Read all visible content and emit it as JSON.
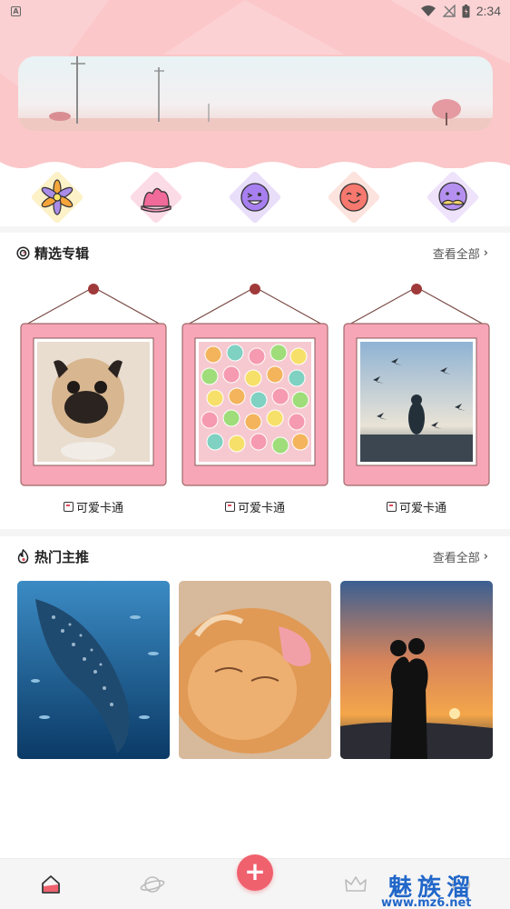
{
  "status_bar": {
    "time": "2:34"
  },
  "categories": [
    {
      "icon": "flower-icon",
      "color": "#fdf1c8"
    },
    {
      "icon": "hat-icon",
      "color": "#fbdbe6"
    },
    {
      "icon": "wink-face-icon",
      "color": "#e9defa"
    },
    {
      "icon": "smile-face-icon",
      "color": "#fde3dd"
    },
    {
      "icon": "mustache-face-icon",
      "color": "#eee3fb"
    }
  ],
  "featured": {
    "title": "精选专辑",
    "more": "查看全部",
    "items": [
      {
        "label": "可爱卡通",
        "image": "pug dog"
      },
      {
        "label": "可爱卡通",
        "image": "colorful candy"
      },
      {
        "label": "可爱卡通",
        "image": "child with birds at sunset"
      }
    ]
  },
  "hot": {
    "title": "热门主推",
    "more": "查看全部",
    "items": [
      {
        "image": "whale shark"
      },
      {
        "image": "orange cat"
      },
      {
        "image": "couple kissing at sunset"
      }
    ]
  },
  "watermark": {
    "text": "魅族溜",
    "url": "www.mz6.net"
  },
  "colors": {
    "header": "#fbc7c9",
    "accent": "#f0616e",
    "frame": "#f7a6b7"
  }
}
